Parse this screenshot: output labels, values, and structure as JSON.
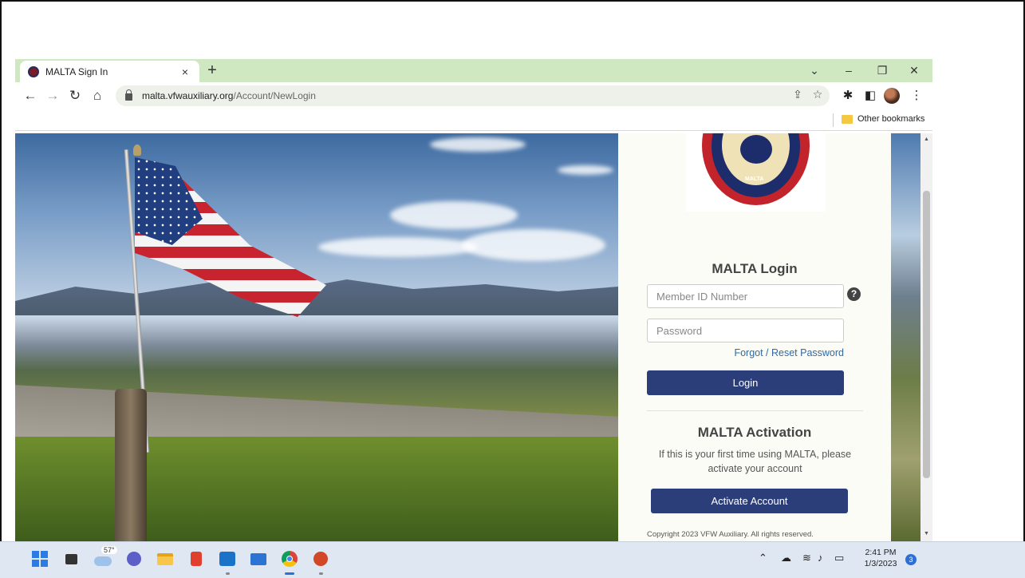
{
  "browser": {
    "tab_title": "MALTA Sign In",
    "tab_close": "×",
    "new_tab": "+",
    "window_controls": {
      "dropdown": "⌄",
      "minimize": "–",
      "restore": "❐",
      "close": "✕"
    },
    "url_host": "malta.vfwauxiliary.org",
    "url_path": "/Account/NewLogin",
    "bookmarks_label": "Other bookmarks"
  },
  "logo": {
    "text": "MALTA"
  },
  "login": {
    "title": "MALTA Login",
    "member_id_placeholder": "Member ID Number",
    "password_placeholder": "Password",
    "help": "?",
    "forgot_link": "Forgot / Reset Password",
    "login_button": "Login"
  },
  "activation": {
    "title": "MALTA Activation",
    "description": "If this is your first time using MALTA, please activate your account",
    "button": "Activate Account"
  },
  "footer": {
    "copyright": "Copyright 2023 VFW Auxiliary. All rights reserved."
  },
  "taskbar": {
    "weather_temp": "57°",
    "time": "2:41 PM",
    "date": "1/3/2023",
    "notification_count": "3",
    "icons": [
      "start-icon",
      "task-view-icon",
      "weather-icon",
      "teams-chat-icon",
      "file-explorer-icon",
      "office-icon",
      "outlook-icon",
      "mail-icon",
      "chrome-icon",
      "powerpoint-icon"
    ]
  },
  "colors": {
    "tab_bar": "#cfe8c2",
    "button": "#2c3e7a",
    "link": "#2f6aa3",
    "panel": "#fcfcf6"
  }
}
